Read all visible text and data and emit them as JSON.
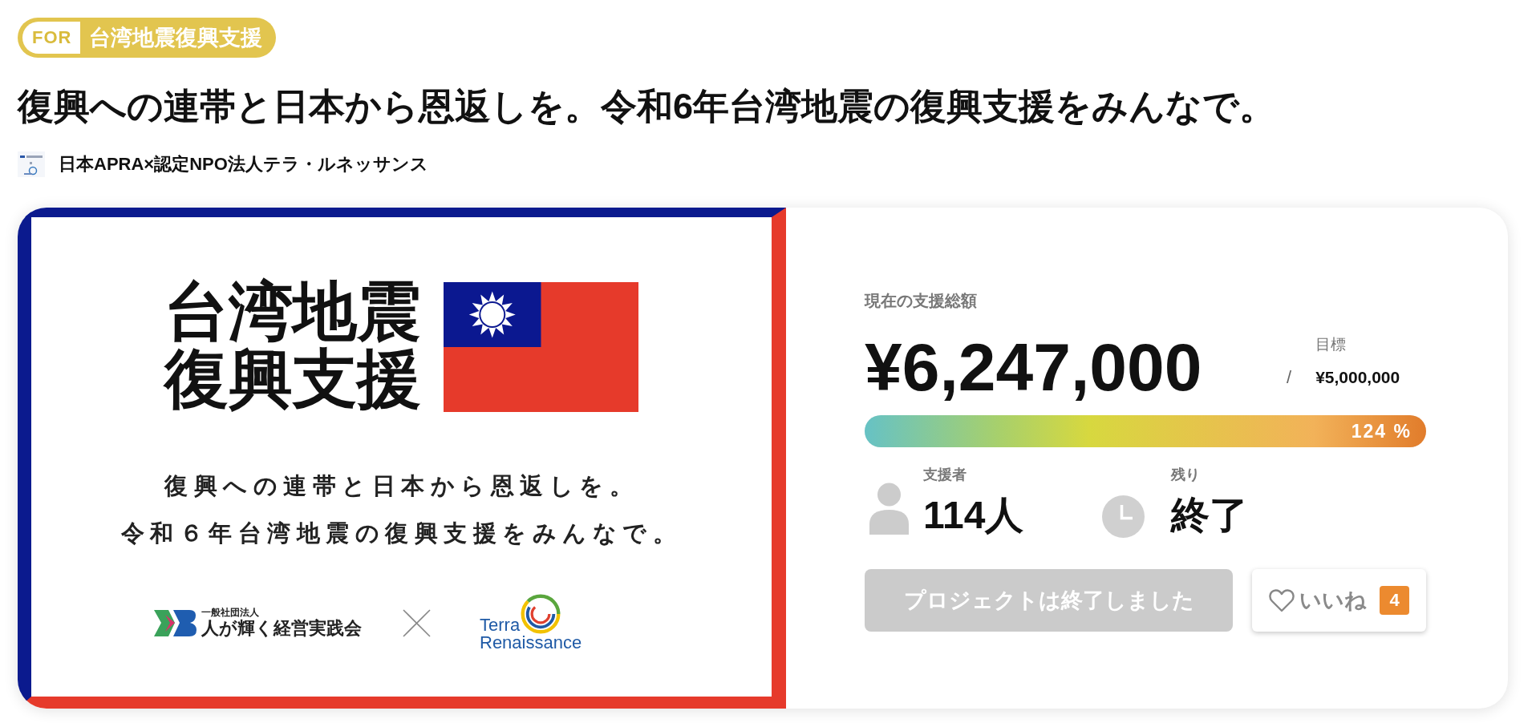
{
  "category": {
    "prefix": "FOR",
    "name": "台湾地震復興支援"
  },
  "title": "復興への連帯と日本から恩返しを。令和6年台湾地震の復興支援をみんなで。",
  "organizer": {
    "name": "日本APRA×認定NPO法人テラ・ルネッサンス"
  },
  "banner": {
    "heading_lines": [
      "台湾地震",
      "復興支援"
    ],
    "tagline_lines": [
      "復興への連帯と日本から恩返しを。",
      "令和６年台湾地震の復興支援をみんなで。"
    ],
    "partners": [
      {
        "kind": "org",
        "caption": "一般社団法人",
        "name_lines": [
          "人が輝く経営実践会"
        ]
      },
      {
        "kind": "terra",
        "name_lines": [
          "Terra",
          "Renaissance"
        ]
      }
    ]
  },
  "funding": {
    "label": "現在の支援総額",
    "amount": "¥6,247,000",
    "separator": "/",
    "goal_label": "目標",
    "goal": "¥5,000,000",
    "progress": {
      "level": 1,
      "percent": "124 %"
    }
  },
  "stats": [
    {
      "kind": "supporters",
      "label": "支援者",
      "value": "114人"
    },
    {
      "kind": "remaining",
      "label": "残り",
      "value": "終了"
    }
  ],
  "actions": {
    "project_button": {
      "label": "プロジェクトは終了しました",
      "disabled": true
    },
    "like_button": {
      "label": "いいね",
      "count": "4"
    }
  }
}
